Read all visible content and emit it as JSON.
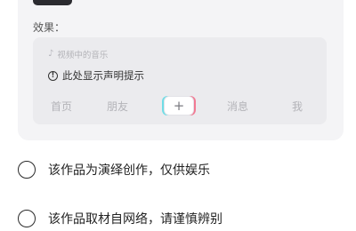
{
  "effect": {
    "label": "效果：",
    "preview": {
      "music_label": "视频中的音乐",
      "music_icon": "music-note-icon",
      "hint_text": "此处显示声明提示",
      "hint_icon": "info-circle-icon",
      "nav": {
        "home": "首页",
        "friends": "朋友",
        "plus": "+",
        "messages": "消息",
        "me": "我"
      }
    }
  },
  "options": [
    {
      "label": "该作品为演绎创作，仅供娱乐"
    },
    {
      "label": "该作品取材自网络，请谨慎辨别"
    }
  ]
}
